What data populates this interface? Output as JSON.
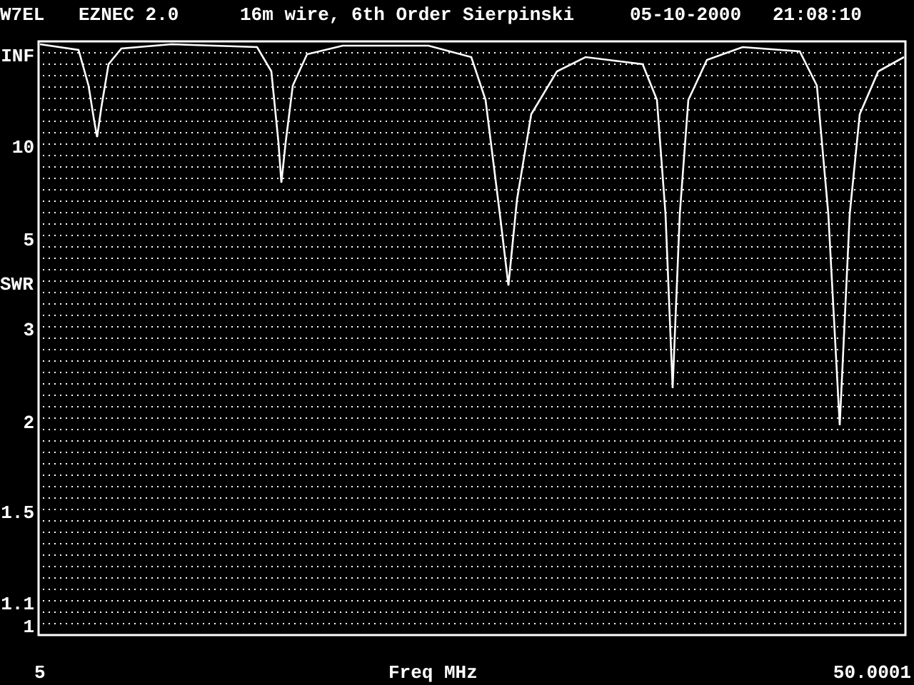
{
  "header": {
    "callsign": "W7EL",
    "program": "EZNEC 2.0",
    "title": "16m wire, 6th Order Sierpinski",
    "date": "05-10-2000",
    "time": "21:08:10"
  },
  "plot": {
    "y_axis": {
      "title": "SWR",
      "labels": [
        "INF",
        "10",
        "5",
        "3",
        "2",
        "1.5",
        "1.1",
        "1"
      ]
    },
    "x_axis": {
      "title": "Freq MHz",
      "labels": [
        "5",
        "50.0001"
      ]
    }
  }
}
